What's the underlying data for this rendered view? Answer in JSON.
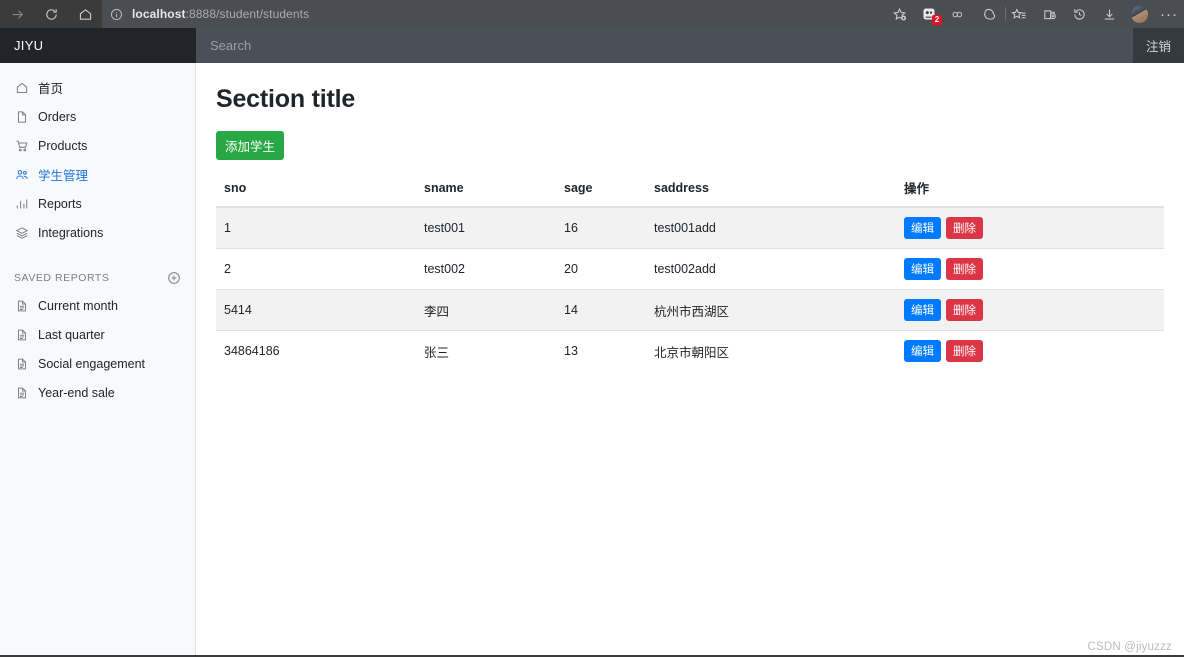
{
  "browser": {
    "nav": [
      {
        "name": "forward-icon",
        "enabled": false
      },
      {
        "name": "reload-icon",
        "enabled": true
      },
      {
        "name": "home-icon",
        "enabled": true
      }
    ],
    "address": {
      "host": "localhost",
      "rest": ":8888/student/students",
      "full": "localhost:8888/student/students",
      "info_icon": "site-info-icon"
    },
    "toolbar_icons": [
      {
        "name": "favorites-add-icon",
        "label": "☆"
      },
      {
        "name": "extension-icon",
        "badge": "2"
      },
      {
        "name": "infinity-icon",
        "label": "∞"
      },
      {
        "name": "browser-essentials-icon",
        "label": ""
      },
      {
        "name": "favorites-list-icon",
        "label": ""
      },
      {
        "name": "collections-icon",
        "label": ""
      },
      {
        "name": "history-icon",
        "label": ""
      },
      {
        "name": "downloads-icon",
        "label": ""
      },
      {
        "name": "profile-avatar",
        "label": ""
      },
      {
        "name": "settings-more-icon",
        "label": "···"
      }
    ]
  },
  "appbar": {
    "brand": "JIYU",
    "search_placeholder": "Search",
    "search_value": "",
    "logout_label": "注销"
  },
  "sidebar": {
    "items": [
      {
        "label": "首页",
        "icon": "home-icon",
        "active": false
      },
      {
        "label": "Orders",
        "icon": "file-icon",
        "active": false
      },
      {
        "label": "Products",
        "icon": "cart-icon",
        "active": false
      },
      {
        "label": "学生管理",
        "icon": "people-icon",
        "active": true
      },
      {
        "label": "Reports",
        "icon": "bar-chart-icon",
        "active": false
      },
      {
        "label": "Integrations",
        "icon": "layers-icon",
        "active": false
      }
    ],
    "saved_reports_heading": "SAVED REPORTS",
    "add_report_icon": "plus-circle-icon",
    "saved_reports": [
      {
        "label": "Current month",
        "icon": "document-icon"
      },
      {
        "label": "Last quarter",
        "icon": "document-icon"
      },
      {
        "label": "Social engagement",
        "icon": "document-icon"
      },
      {
        "label": "Year-end sale",
        "icon": "document-icon"
      }
    ]
  },
  "main": {
    "page_title": "Section title",
    "add_button_label": "添加学生",
    "table": {
      "columns": [
        "sno",
        "sname",
        "sage",
        "saddress",
        "操作"
      ],
      "rows": [
        {
          "sno": "1",
          "sname": "test001",
          "sage": "16",
          "saddress": "test001add",
          "edit": "编辑",
          "del": "删除"
        },
        {
          "sno": "2",
          "sname": "test002",
          "sage": "20",
          "saddress": "test002add",
          "edit": "编辑",
          "del": "删除"
        },
        {
          "sno": "5414",
          "sname": "李四",
          "sage": "14",
          "saddress": "杭州市西湖区",
          "edit": "编辑",
          "del": "删除"
        },
        {
          "sno": "34864186",
          "sname": "张三",
          "sage": "13",
          "saddress": "北京市朝阳区",
          "edit": "编辑",
          "del": "删除"
        }
      ]
    }
  },
  "watermark": "CSDN @jiyuzzz",
  "colors": {
    "brand_bg": "#212529",
    "navbar_bg": "#343a40",
    "search_bg": "#4a5057",
    "sidebar_bg": "#f8f9fa",
    "accent_active": "#1f74e0",
    "add_button": "#28a745",
    "edit_button": "#007bff",
    "delete_button": "#dc3545",
    "row_stripe": "#f2f2f2"
  }
}
